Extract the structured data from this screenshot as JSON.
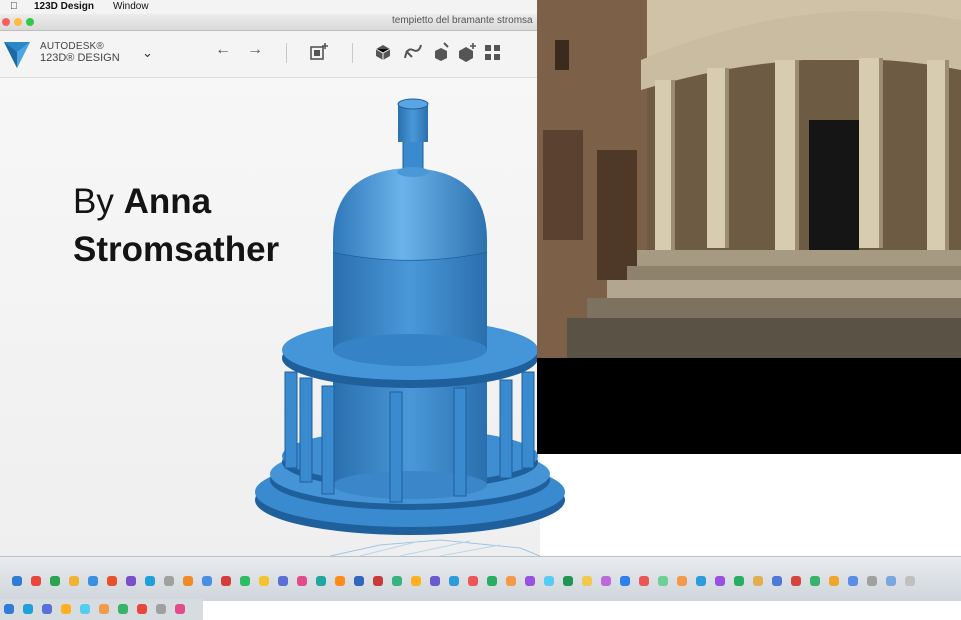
{
  "menubar": {
    "apple": "",
    "app_name": "123D Design",
    "window_menu": "Window"
  },
  "window": {
    "document_title": "tempietto del bramante stromsa"
  },
  "toolbar": {
    "brand_line1": "AUTODESK®",
    "brand_line2": "123D® DESIGN",
    "menu_chevron": "⌄",
    "undo": "←",
    "redo": "→"
  },
  "caption": {
    "by": "By",
    "first_name": "Anna",
    "last_name": "Stromsather"
  },
  "colors": {
    "model_blue": "#3a8ad0",
    "model_shadow": "#1e5f9c",
    "model_light": "#6bb3ea",
    "logo_blue": "#2b88c8"
  },
  "dock": {
    "icon_colors": [
      "#2f7bd6",
      "#e8453c",
      "#2aa44f",
      "#f2b233",
      "#3a8fe0",
      "#e6522c",
      "#7b4fc9",
      "#1fa0d8",
      "#a0a0a0",
      "#f08a24",
      "#4a90e2",
      "#d63e3e",
      "#2ebc62",
      "#f4c430",
      "#5b6fd6",
      "#e24c8b",
      "#22a7a0",
      "#ff8c1a",
      "#3066be",
      "#c93b3b",
      "#36b37e",
      "#ffb020",
      "#6a5acd",
      "#2d9cdb",
      "#eb5757",
      "#27ae60",
      "#f2994a",
      "#9b51e0",
      "#56ccf2",
      "#219653",
      "#f2c94c",
      "#bb6bd9",
      "#2f80ed",
      "#eb5757",
      "#6fcf97",
      "#f2994a",
      "#2d9cdb",
      "#9b51e0",
      "#27ae60",
      "#e0b050",
      "#4f79d6",
      "#d6453c",
      "#3ab26a",
      "#f0a62c",
      "#5a8ee6",
      "#a0a0a0",
      "#7aa7e0",
      "#c0c0c0"
    ]
  }
}
